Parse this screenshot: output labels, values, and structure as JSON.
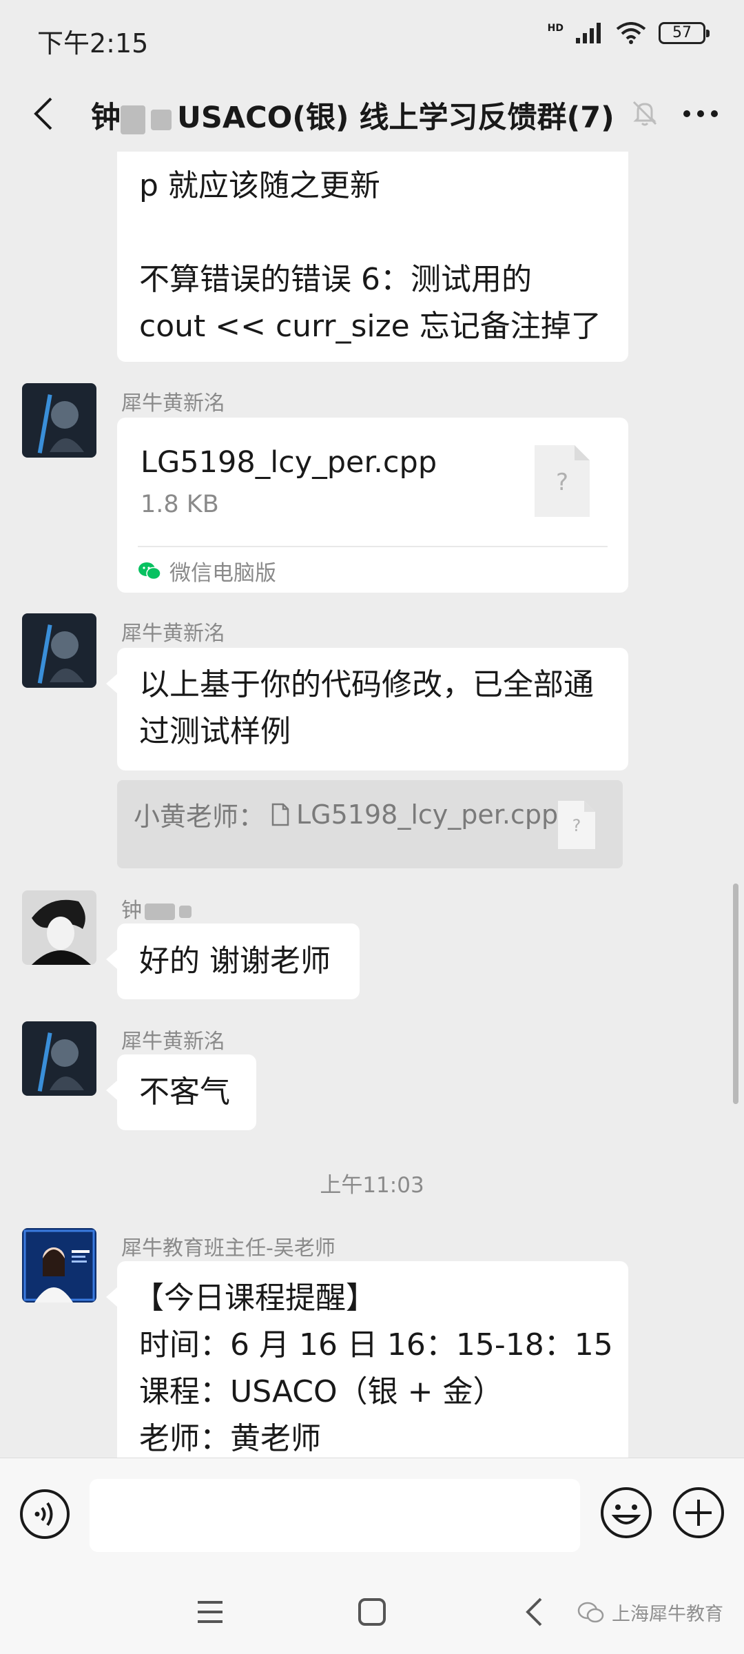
{
  "status_bar": {
    "time": "下午2:15",
    "network": "HD",
    "battery": "57"
  },
  "header": {
    "title": "钟",
    "title_suffix": "USACO(银) 线上学习反馈群(7)"
  },
  "messages": {
    "partial": {
      "lines": [
        "p 就应该随之更新",
        "",
        "不算错误的错误 6：测试用的",
        "cout << curr_size 忘记备注掉了"
      ]
    },
    "file_msg": {
      "sender": "犀牛黄新洺",
      "file_name": "LG5198_lcy_per.cpp",
      "file_size": "1.8 KB",
      "file_icon_glyph": "?",
      "source": "微信电脑版"
    },
    "reply_msg": {
      "sender": "犀牛黄新洺",
      "lines": [
        "以上基于你的代码修改，已全部通",
        "过测试样例"
      ],
      "quote_prefix": "小黄老师：",
      "quote_file": "LG5198_lcy_per.cpp",
      "quote_icon_glyph": "?"
    },
    "thanks_msg": {
      "sender": "钟",
      "text": "好的 谢谢老师"
    },
    "welcome_msg": {
      "sender": "犀牛黄新洺",
      "text": "不客气"
    },
    "timestamp": "上午11:03",
    "reminder_msg": {
      "sender": "犀牛教育班主任-吴老师",
      "lines": [
        "【今日课程提醒】",
        "时间：6 月 16 日 16：15-18：15",
        "课程：USACO（银 + 金）",
        "老师：黄老师"
      ]
    }
  },
  "watermark": {
    "text": "上海犀牛教育"
  },
  "icons": {
    "back": "back-arrow-icon",
    "mute": "mute-bell-icon",
    "more": "more-icon",
    "voice": "voice-icon",
    "emoji": "emoji-icon",
    "plus": "plus-icon",
    "file": "file-icon",
    "wechat": "wechat-icon"
  },
  "colors": {
    "background": "#ededed",
    "bubble": "#ffffff",
    "quote_bg": "#dedede",
    "meta_text": "#8a8a8a",
    "wechat_green": "#07c160"
  }
}
